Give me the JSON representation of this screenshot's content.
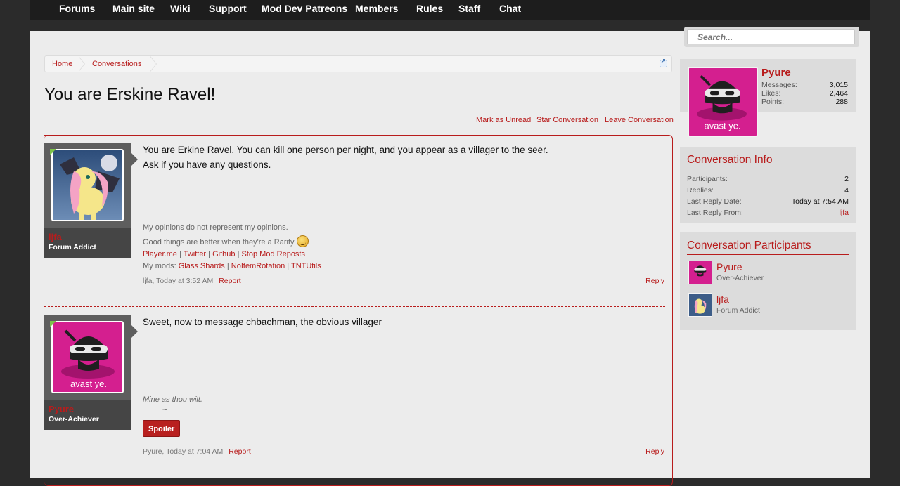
{
  "nav": {
    "items": [
      "Forums",
      "Main site",
      "Wiki",
      "Support",
      "Mod Dev Patreons",
      "Members",
      "Rules",
      "Staff",
      "Chat"
    ]
  },
  "search": {
    "placeholder": "Search..."
  },
  "breadcrumb": {
    "home": "Home",
    "conversations": "Conversations"
  },
  "conversation": {
    "title": "You are Erskine Ravel!",
    "actions": {
      "mark_unread": "Mark as Unread",
      "star": "Star Conversation",
      "leave": "Leave Conversation"
    }
  },
  "messages": [
    {
      "user": "ljfa",
      "user_title": "Forum Addict",
      "lines": [
        "You are Erkine Ravel. You can kill one person per night, and you appear as a villager to the seer.",
        "Ask if you have any questions."
      ],
      "signature": {
        "line1": "My opinions do not represent my opinions.",
        "line2": "Good things are better when they're a Rarity",
        "links": [
          "Player.me",
          "Twitter",
          "Github",
          "Stop Mod Reposts"
        ],
        "mods_label": "My mods:",
        "mods": [
          "Glass Shards",
          "NoItemRotation",
          "TNTUtils"
        ]
      },
      "meta": "ljfa, Today at 3:52 AM",
      "report": "Report",
      "reply": "Reply"
    },
    {
      "user": "Pyure",
      "user_title": "Over-Achiever",
      "avatar_caption": "avast ye.",
      "lines": [
        "Sweet, now to message chbachman, the obvious villager"
      ],
      "signature": {
        "line1": "Mine as thou wilt.",
        "line2": "~"
      },
      "spoiler": "Spoiler",
      "meta": "Pyure, Today at 7:04 AM",
      "report": "Report",
      "reply": "Reply"
    }
  ],
  "sidebar": {
    "profile": {
      "name": "Pyure",
      "avatar_caption": "avast ye.",
      "stats": [
        {
          "label": "Messages:",
          "value": "3,015"
        },
        {
          "label": "Likes:",
          "value": "2,464"
        },
        {
          "label": "Points:",
          "value": "288"
        }
      ]
    },
    "info": {
      "heading": "Conversation Info",
      "rows": [
        {
          "label": "Participants:",
          "value": "2"
        },
        {
          "label": "Replies:",
          "value": "4"
        },
        {
          "label": "Last Reply Date:",
          "value": "Today at 7:54 AM"
        },
        {
          "label": "Last Reply From:",
          "value": "ljfa"
        }
      ]
    },
    "participants": {
      "heading": "Conversation Participants",
      "list": [
        {
          "name": "Pyure",
          "title": "Over-Achiever",
          "avatar_caption": "avast ye."
        },
        {
          "name": "ljfa",
          "title": "Forum Addict"
        }
      ]
    }
  },
  "colors": {
    "accent": "#b81c1c",
    "avatar_pink": "#d41f8f",
    "page_bg": "#ececec",
    "sidebar_bg": "#dcdcdc"
  }
}
